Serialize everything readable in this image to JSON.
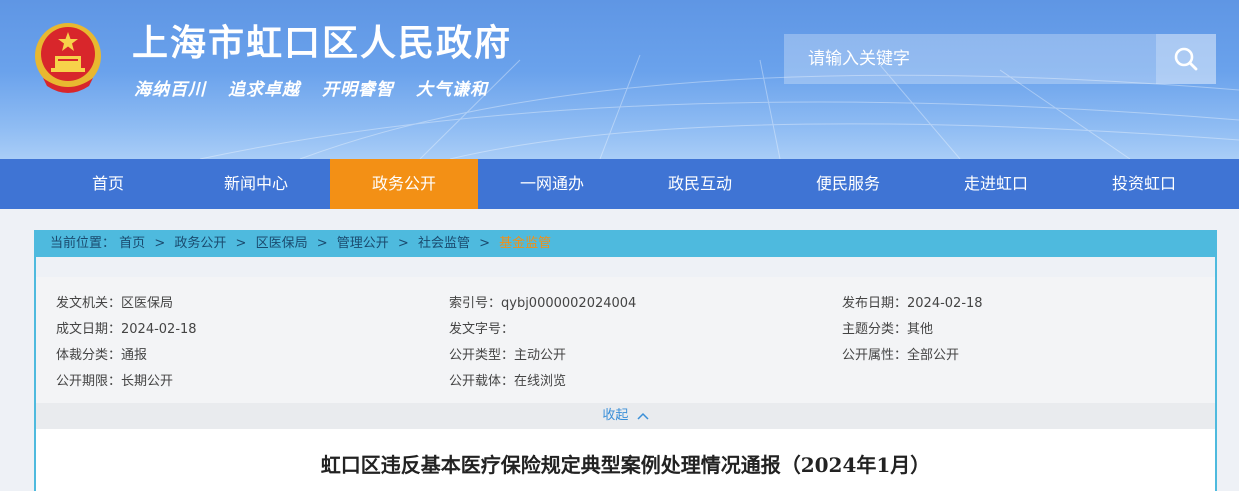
{
  "header": {
    "site_title": "上海市虹口区人民政府",
    "slogans": [
      "海纳百川",
      "追求卓越",
      "开明睿智",
      "大气谦和"
    ],
    "search_placeholder": "请输入关键字"
  },
  "nav": {
    "items": [
      "首页",
      "新闻中心",
      "政务公开",
      "一网通办",
      "政民互动",
      "便民服务",
      "走进虹口",
      "投资虹口"
    ],
    "active": "政务公开"
  },
  "breadcrumb": {
    "prefix": "当前位置：",
    "items": [
      "首页",
      "政务公开",
      "区医保局",
      "管理公开",
      "社会监管"
    ],
    "current": "基金监管",
    "separator": ">"
  },
  "meta": {
    "issuer": "发文机关：区医保局",
    "index_no": "索引号：qybj0000002024004",
    "publish_date": "发布日期：2024-02-18",
    "created_date": "成文日期：2024-02-18",
    "doc_no": "发文字号：",
    "topic": "主题分类：其他",
    "genre": "体裁分类：通报",
    "open_type": "公开类型：主动公开",
    "open_attr": "公开属性：全部公开",
    "open_term": "公开期限：长期公开",
    "carrier": "公开载体：在线浏览"
  },
  "collapse_label": "收起",
  "doc_title": "虹口区违反基本医疗保险规定典型案例处理情况通报（2024年1月）",
  "colors": {
    "nav_bg": "#3f74d4",
    "nav_active": "#f39015",
    "breadcrumb_bg": "#4ebade",
    "link_blue": "#3a8fd8"
  }
}
